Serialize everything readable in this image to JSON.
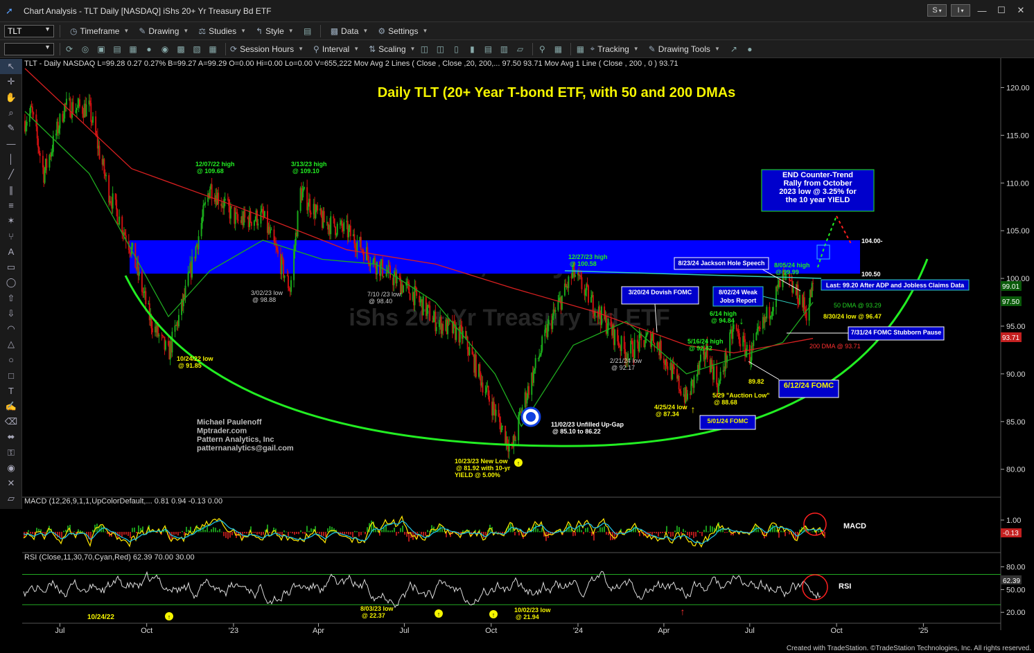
{
  "window": {
    "title": "Chart Analysis - TLT Daily [NASDAQ] iShs 20+ Yr Treasury Bd ETF",
    "btn_s": "S",
    "btn_i": "I",
    "minimize": "—",
    "maximize": "☐",
    "close": "✕"
  },
  "toolbar1": {
    "symbol": "TLT",
    "items": [
      {
        "label": "Timeframe"
      },
      {
        "label": "Drawing"
      },
      {
        "label": "Studies"
      },
      {
        "label": "Style"
      },
      {
        "label": "Data"
      },
      {
        "label": "Settings"
      }
    ]
  },
  "toolbar2": {
    "items": [
      {
        "label": "Session Hours"
      },
      {
        "label": "Interval"
      },
      {
        "label": "Scaling"
      },
      {
        "label": "Tracking"
      },
      {
        "label": "Drawing Tools"
      }
    ]
  },
  "left_tools": [
    "pointer-icon",
    "crosshair-icon",
    "hand-icon",
    "zoom-icon",
    "pencil-icon",
    "horizontal-line-icon",
    "vertical-line-icon",
    "trendline-icon",
    "channel-icon",
    "fib-icon",
    "gann-icon",
    "pitchfork-icon",
    "text-icon",
    "rect-icon",
    "ellipse-icon",
    "arrow-up-icon",
    "arrow-down-icon",
    "arc-icon",
    "triangle-icon",
    "circle-icon",
    "square-icon",
    "t-icon",
    "brush-icon",
    "eraser-icon",
    "magnet-icon",
    "lock-icon",
    "eye-icon",
    "trash-icon",
    "ruler-icon"
  ],
  "chart_header": {
    "text": "TLT - Daily  NASDAQ  L=99.28  0.27   0.27%     B=99.27  A=99.29  O=0.00  Hi=0.00  Lo=0.00  V=655,222  Mov Avg 2 Lines (       Close ,         Close ,20,  200,...  97.50  93.71  Mov Avg 1 Line (  Close , 200 ,  0 )  93.71"
  },
  "watermark": {
    "line1": "TLT, Daily",
    "line2": "iShs 20+ Yr Treasury Bd ETF"
  },
  "colors": {
    "ma50": "#1faa1f",
    "ma200": "#d92020",
    "zone": "#0000ff",
    "annot_yellow": "#f5f500",
    "annot_green": "#22ee22",
    "lime": "#22ee22",
    "up": "#1aaa1a",
    "down": "#cc1111"
  },
  "chart_data": [
    {
      "type": "line",
      "title": "Daily TLT (20+ Year T-bond ETF, with 50 and 200 DMAs",
      "panel": "price",
      "ylim": [
        77.8,
        122.5
      ],
      "y_ticks": [
        "120.00",
        "115.00",
        "110.00",
        "105.00",
        "100.00",
        "95.00",
        "90.00",
        "85.00",
        "80.00"
      ],
      "x_ticks": [
        "Jul",
        "Oct",
        "'23",
        "Apr",
        "Jul",
        "Oct",
        "'24",
        "Apr",
        "Jul",
        "Oct",
        "'25"
      ],
      "x_range": [
        "2022-05-25",
        "2025-03-10"
      ],
      "series": [
        {
          "name": "",
          "kind": "candles-close",
          "x": [
            "2022-05-25",
            "2022-06-01",
            "2022-06-14",
            "2022-07-06",
            "2022-08-01",
            "2022-08-22",
            "2022-09-15",
            "2022-10-05",
            "2022-10-24",
            "2022-11-10",
            "2022-12-07",
            "2023-01-05",
            "2023-02-01",
            "2023-03-02",
            "2023-03-13",
            "2023-04-05",
            "2023-05-01",
            "2023-06-01",
            "2023-07-10",
            "2023-08-03",
            "2023-09-01",
            "2023-10-05",
            "2023-10-23",
            "2023-11-02",
            "2023-12-01",
            "2023-12-27",
            "2024-01-19",
            "2024-02-21",
            "2024-03-20",
            "2024-04-25",
            "2024-05-16",
            "2024-05-29",
            "2024-06-14",
            "2024-07-01",
            "2024-08-05",
            "2024-08-23",
            "2024-08-30",
            "2024-09-06"
          ],
          "values": [
            116.5,
            117.5,
            111.0,
            118.0,
            117.8,
            109.0,
            103.0,
            95.6,
            92.0,
            98.0,
            109.68,
            106.0,
            106.5,
            98.88,
            109.1,
            106.0,
            105.0,
            101.5,
            98.4,
            95.5,
            94.0,
            86.0,
            81.92,
            86.2,
            95.0,
            100.58,
            97.0,
            92.17,
            94.0,
            87.34,
            92.42,
            88.68,
            94.84,
            91.8,
            99.99,
            98.0,
            96.47,
            99.2
          ]
        },
        {
          "name": "",
          "kind": "ma50",
          "x": [
            "2022-05-25",
            "2022-08-01",
            "2022-10-24",
            "2022-12-07",
            "2023-02-01",
            "2023-04-05",
            "2023-06-01",
            "2023-08-03",
            "2023-10-05",
            "2023-11-02",
            "2023-12-27",
            "2024-02-21",
            "2024-04-25",
            "2024-06-14",
            "2024-08-05",
            "2024-09-06"
          ],
          "values": [
            117.5,
            111.0,
            96.0,
            100.8,
            104.0,
            102.0,
            101.5,
            97.5,
            90.0,
            84.5,
            93.0,
            95.5,
            90.0,
            91.6,
            93.29,
            97.5
          ]
        },
        {
          "name": "",
          "kind": "ma200",
          "x": [
            "2022-05-25",
            "2022-09-15",
            "2023-01-05",
            "2023-05-01",
            "2023-08-03",
            "2023-10-23",
            "2024-01-19",
            "2024-04-25",
            "2024-06-14",
            "2024-09-06"
          ],
          "values": [
            122.0,
            111.5,
            107.5,
            103.0,
            101.5,
            99.0,
            96.5,
            93.0,
            92.2,
            93.71
          ]
        }
      ],
      "zone": {
        "low": 100.5,
        "high": 104.0,
        "label_low": "100.50",
        "label_high": "104.00-"
      },
      "last_price": "99.01",
      "ma50_last": "97.50",
      "ma200_last": "93.71"
    },
    {
      "type": "line",
      "panel": "MACD",
      "title": "MACD",
      "legend": "MACD (12,26,9,1,1,UpColorDefault,...  0.81  0.94  -0.13  0.00",
      "y_ticks": [
        "1.00"
      ],
      "last": "-0.13"
    },
    {
      "type": "line",
      "panel": "RSI",
      "title": "RSI",
      "legend": "RSI (Close,11,30,70,Cyan,Red)  62.39  70.00  30.00",
      "ylim": [
        12,
        86
      ],
      "y_ticks": [
        "80.00",
        "50.00",
        "20.00"
      ],
      "last": "62.39"
    }
  ],
  "annotations": {
    "a1": {
      "l1": "12/07/22 high",
      "l2": "@ 109.68"
    },
    "a2": {
      "l1": "3/13/23 high",
      "l2": "@ 109.10"
    },
    "a3": {
      "l1": "3/02/23 low",
      "l2": "@ 98.88"
    },
    "a4": {
      "l1": "7/10 /23 low",
      "l2": "@ 98.40"
    },
    "a5": {
      "l1": "10/24/22 low",
      "l2": "@ 91.85"
    },
    "a6": {
      "l1": "12/27/23 high",
      "l2": "@ 100.58"
    },
    "a7": {
      "l1": "2/21/24 low",
      "l2": "@ 92.17"
    },
    "a8": {
      "l1": "5/16/24 high",
      "l2": "@ 92.42"
    },
    "a9": {
      "l1": "6/14 high",
      "l2": "@ 94.84"
    },
    "a10": {
      "l1": "8/05/24 high",
      "l2": "@ 99.99"
    },
    "a11": {
      "l1": "8/30/24 low @ 96.47"
    },
    "a12": {
      "l1": "50 DMA @ 93.29"
    },
    "a13": {
      "l1": "200 DMA @ 93.71"
    },
    "a14": {
      "l1": "89.82"
    },
    "a15": {
      "l1": "5/29 \"Auction Low\"",
      "l2": "@ 88.68"
    },
    "a16": {
      "l1": "4/25/24 low",
      "l2": "@ 87.34"
    },
    "a17": {
      "l1": "11/02/23 Unfilled Up-Gap",
      "l2": "@ 85.10 to 86.22"
    },
    "a18": {
      "l1": "10/23/23 New Low",
      "l2": "@ 81.92 with 10-yr",
      "l3": "YIELD @ 5.00%"
    },
    "author": {
      "l1": "Michael Paulenoff",
      "l2": "Mptrader.com",
      "l3": "Pattern Analytics, Inc",
      "l4": "patternanalytics@gail.com"
    },
    "box_end": {
      "l1": "END Counter-Trend",
      "l2": "Rally from October",
      "l3": "2023 low @ 3.25% for",
      "l4": "the 10 year YIELD"
    },
    "box_jackson": {
      "l1": "8/23/24 Jackson Hole Speech"
    },
    "box_last": {
      "l1": "Last: 99.20 After ADP and Jobless Claims Data"
    },
    "box_dovish": {
      "l1": "3/20/24 Dovish FOMC"
    },
    "box_weak": {
      "l1": "8/02/24 Weak",
      "l2": "Jobs Report"
    },
    "box_pause": {
      "l1": "7/31/24 FOMC Stubborn Pause"
    },
    "box_612": {
      "l1": "6/12/24 FOMC"
    },
    "box_501": {
      "l1": "5/01/24 FOMC"
    },
    "rsi1": {
      "l1": "10/24/22"
    },
    "rsi2": {
      "l1": "8/03/23 low",
      "l2": "@ 22.37"
    },
    "rsi3": {
      "l1": "10/02/23 low",
      "l2": "@ 21.94"
    }
  },
  "footer": "Created with TradeStation. ©TradeStation Technologies, Inc. All rights reserved."
}
